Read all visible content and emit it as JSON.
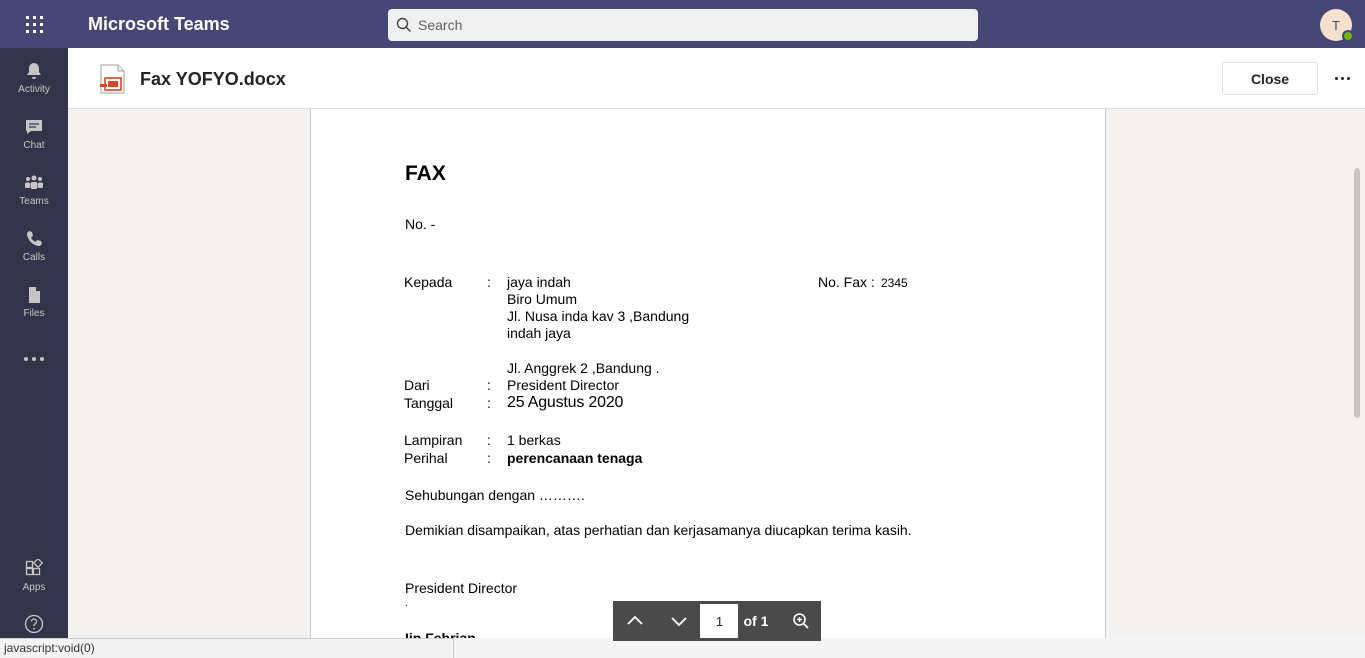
{
  "app": {
    "title": "Microsoft Teams"
  },
  "search": {
    "placeholder": "Search"
  },
  "user": {
    "initial": "T"
  },
  "rail": {
    "items": [
      {
        "label": "Activity",
        "icon": "bell-icon"
      },
      {
        "label": "Chat",
        "icon": "chat-icon"
      },
      {
        "label": "Teams",
        "icon": "teams-icon"
      },
      {
        "label": "Calls",
        "icon": "phone-icon"
      },
      {
        "label": "Files",
        "icon": "file-icon"
      }
    ],
    "apps_label": "Apps"
  },
  "file": {
    "name": "Fax YOFYO.docx",
    "close_label": "Close"
  },
  "document": {
    "title": "FAX",
    "number": "No. -",
    "kepada_label": "Kepada",
    "colon": ":",
    "recipient": [
      "jaya indah",
      "Biro Umum",
      "Jl. Nusa inda kav 3 ,Bandung",
      "indah jaya"
    ],
    "recipient_address": "Jl. Anggrek 2 ,Bandung .",
    "fax_label": "No. Fax :",
    "fax_number": "2345",
    "dari_label": "Dari",
    "dari_value": "President Director",
    "tanggal_label": "Tanggal",
    "tanggal_value": "25 Agustus 2020",
    "lampiran_label": "Lampiran",
    "lampiran_value": "1 berkas",
    "perihal_label": "Perihal",
    "perihal_value": "perencanaan tenaga",
    "body_1": "Sehubungan dengan ……….",
    "body_2": "Demikian disampaikan, atas perhatian dan kerjasamanya diucapkan terima kasih.",
    "signature_title": "President Director",
    "signature_dot": ".",
    "signature_name": "Iin Febrian"
  },
  "pager": {
    "current_page": "1",
    "of_label": "of 1"
  },
  "status": {
    "text": "javascript:void(0)"
  },
  "colors": {
    "topbar": "#464775",
    "rail": "#33344a",
    "presence": "#6bb700"
  }
}
